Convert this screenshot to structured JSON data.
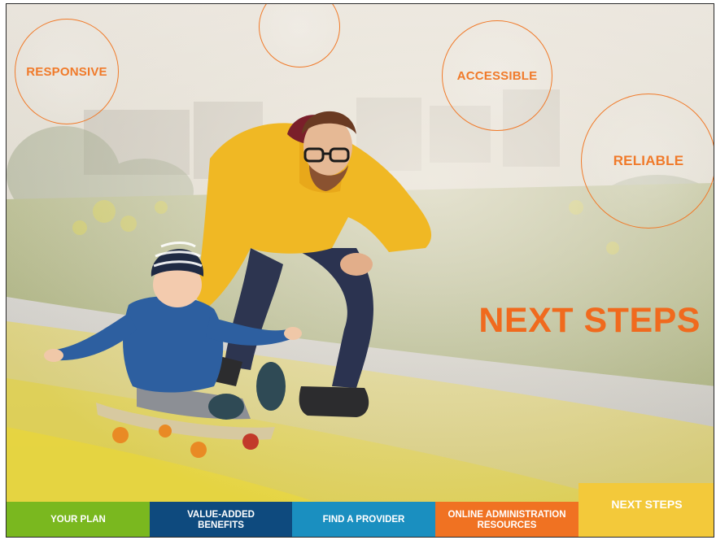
{
  "bubbles": [
    {
      "label": "RESPONSIVE"
    },
    {
      "label": ""
    },
    {
      "label": "ACCESSIBLE"
    },
    {
      "label": "RELIABLE"
    }
  ],
  "headline": "NEXT STEPS",
  "tabs": [
    {
      "label": "YOUR PLAN",
      "color": "#7ab81f"
    },
    {
      "label": "VALUE-ADDED BENEFITS",
      "color": "#0e4a7e"
    },
    {
      "label": "FIND A PROVIDER",
      "color": "#1a8fc0"
    },
    {
      "label": "ONLINE ADMINISTRATION RESOURCES",
      "color": "#f07222"
    },
    {
      "label": "NEXT STEPS",
      "color": "#f3c93a",
      "active": true
    }
  ],
  "colors": {
    "accent": "#f07a2a",
    "headline": "#f06a1e"
  }
}
